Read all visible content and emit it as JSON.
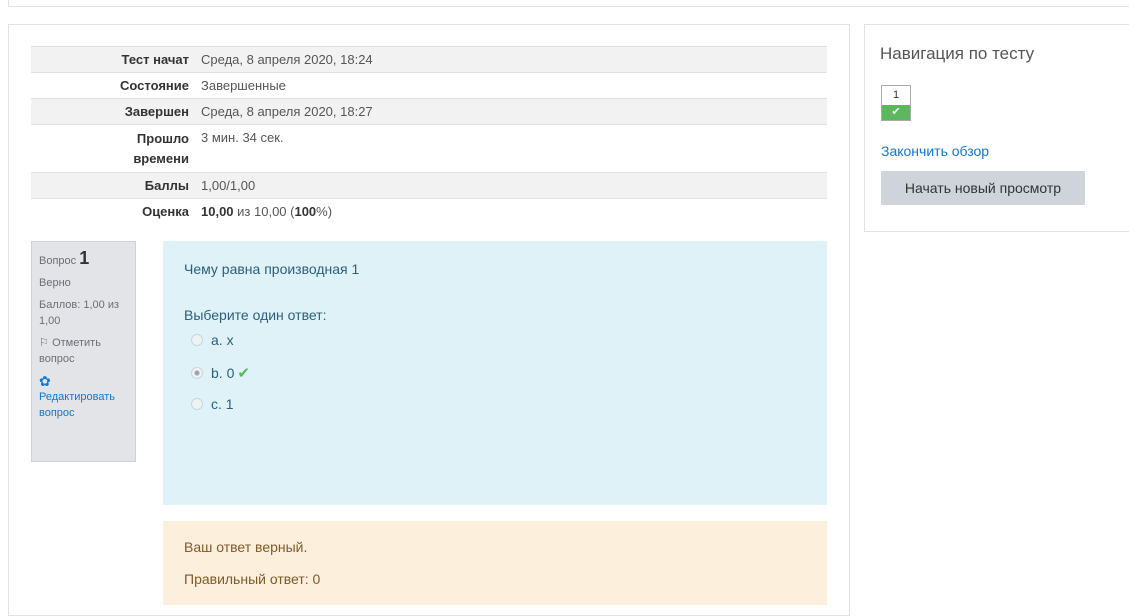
{
  "summary": [
    {
      "label": "Тест начат",
      "value": "Среда, 8 апреля 2020, 18:24"
    },
    {
      "label": "Состояние",
      "value": "Завершенные"
    },
    {
      "label": "Завершен",
      "value": "Среда, 8 апреля 2020, 18:27"
    },
    {
      "label": "Прошло времени",
      "label_line1": "Прошло",
      "label_line2": "времени",
      "value": "3 мин. 34 сек."
    },
    {
      "label": "Баллы",
      "value": "1,00/1,00"
    },
    {
      "label": "Оценка",
      "value_bold": "10,00",
      "value_mid": " из 10,00 (",
      "value_pct": "100",
      "value_end": "%)"
    }
  ],
  "question": {
    "label": "Вопрос",
    "number": "1",
    "state": "Верно",
    "marks": "Баллов: 1,00 из 1,00",
    "flag_label": "Отметить вопрос",
    "edit_label": "Редактировать вопрос",
    "text": "Чему равна производная 1",
    "prompt": "Выберите один ответ:",
    "options": [
      {
        "label": "a. x",
        "checked": false
      },
      {
        "label": "b. 0",
        "checked": true,
        "correct": true
      },
      {
        "label": "c. 1",
        "checked": false
      }
    ]
  },
  "feedback": {
    "general": "Ваш ответ верный.",
    "right_answer": "Правильный ответ: 0"
  },
  "navigation": {
    "title": "Навигация по тесту",
    "buttons": [
      {
        "number": "1",
        "status": "correct"
      }
    ],
    "finish_review": "Закончить обзор",
    "start_new": "Начать новый просмотр"
  },
  "colors": {
    "accent": "#1177d1",
    "correct": "#5cb85c",
    "question_bg": "#def2f8",
    "feedback_bg": "#fcefdc"
  },
  "icons": {
    "flag": "flag-icon",
    "edit": "gear-icon",
    "correct": "check-icon"
  }
}
